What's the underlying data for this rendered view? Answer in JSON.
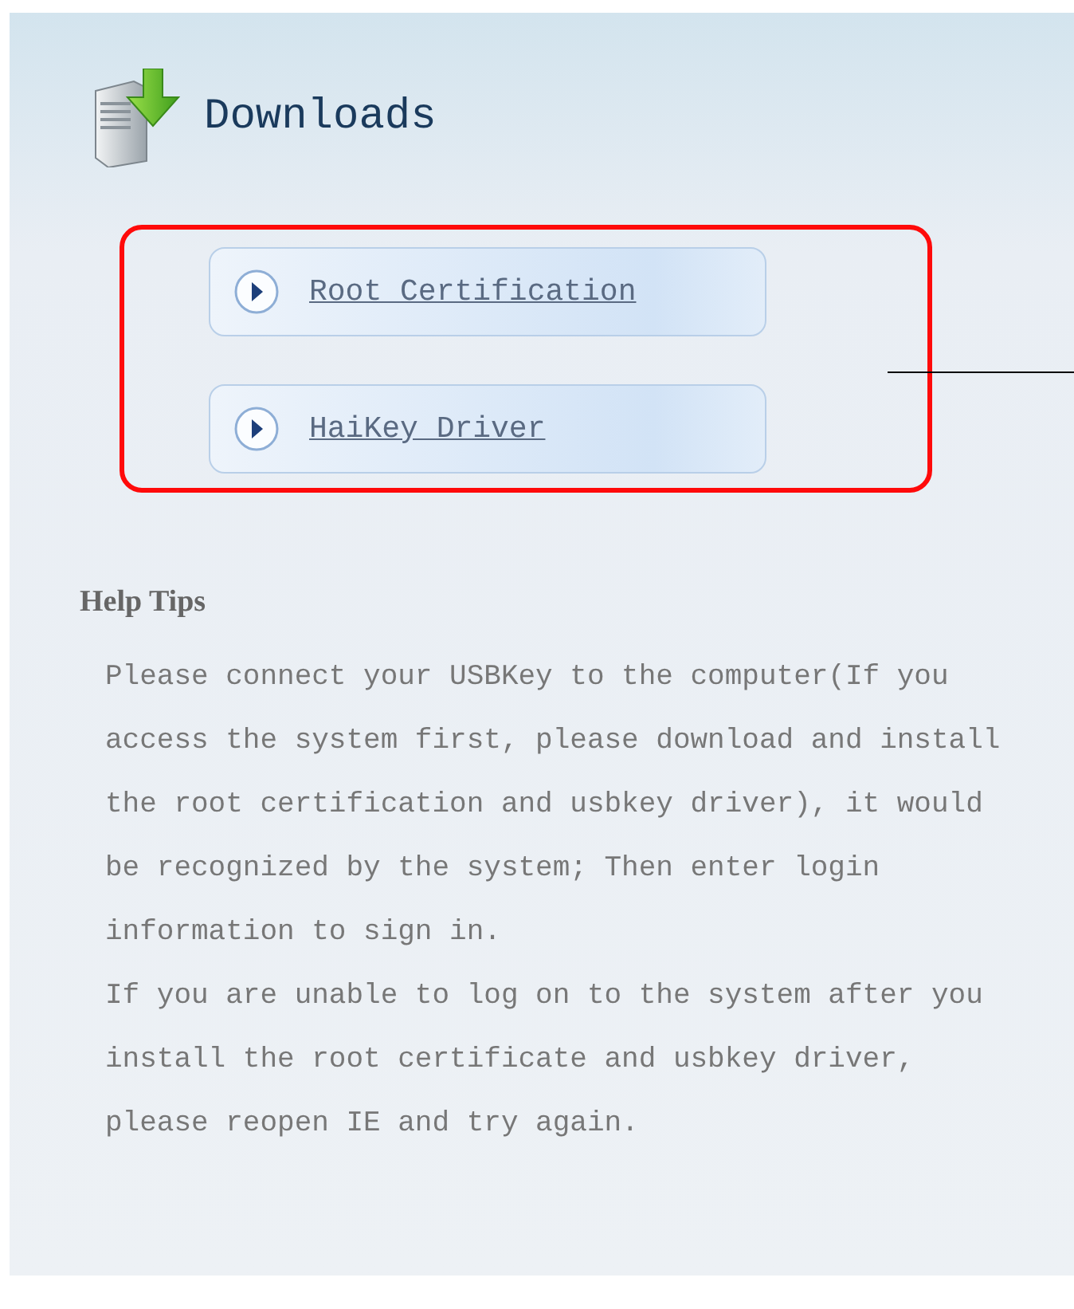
{
  "header": {
    "title": "Downloads"
  },
  "downloads": [
    {
      "label": "Root Certification"
    },
    {
      "label": "HaiKey Driver"
    }
  ],
  "help": {
    "title": "Help Tips",
    "paragraphs": [
      "Please connect your USBKey to the computer(If you access the system first, please download and install the root certification and usbkey driver), it would be recognized by the system; Then enter login information to sign in.",
      "If you are unable to log on to the system after you install the root certificate and usbkey driver, please reopen IE and try again."
    ]
  }
}
